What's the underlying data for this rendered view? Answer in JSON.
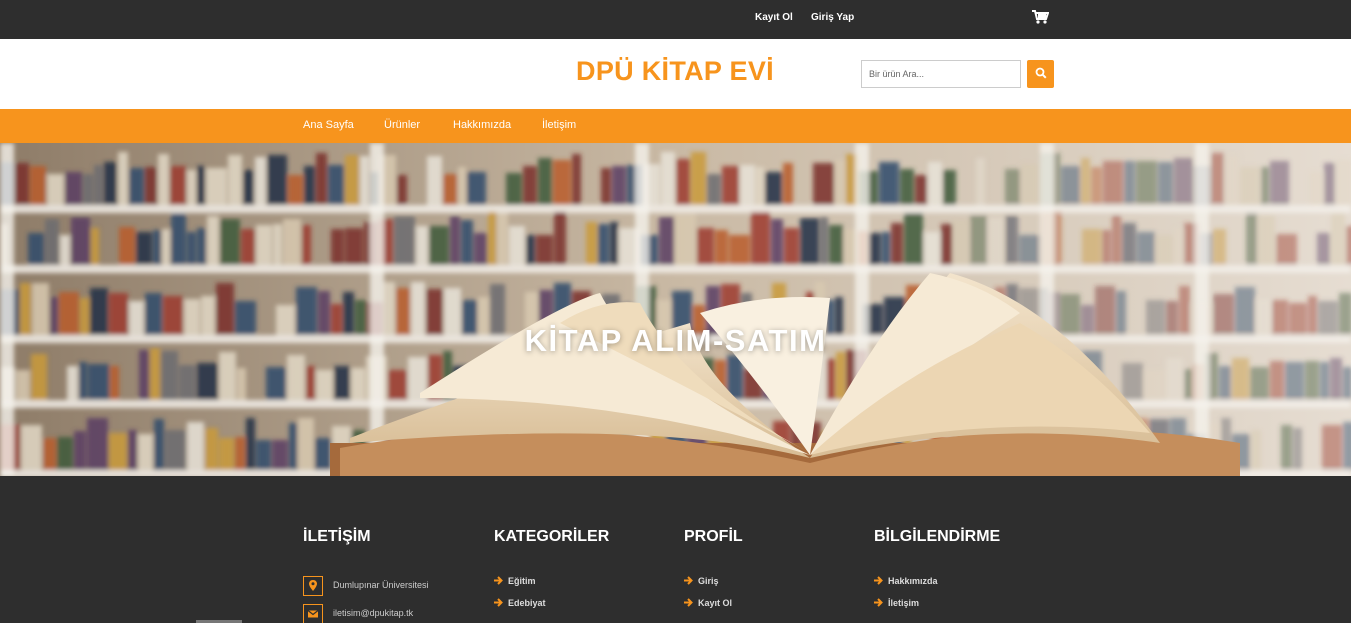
{
  "topbar": {
    "register_label": "Kayıt Ol",
    "login_label": "Giriş Yap",
    "cart_icon": "cart-icon"
  },
  "header": {
    "logo": "DPÜ KİTAP EVİ",
    "search_placeholder": "Bir ürün Ara...",
    "search_icon": "search-icon"
  },
  "nav": {
    "items": [
      {
        "label": "Ana Sayfa"
      },
      {
        "label": "Ürünler"
      },
      {
        "label": "Hakkımızda"
      },
      {
        "label": "İletişim"
      }
    ]
  },
  "hero": {
    "title": "KİTAP ALIM-SATIM"
  },
  "footer": {
    "contact": {
      "title": "İLETİŞİM",
      "address": "Dumlupınar Üniversitesi",
      "email": "iletisim@dpukitap.tk"
    },
    "categories": {
      "title": "KATEGORİLER",
      "items": [
        "Eğitim",
        "Edebiyat"
      ]
    },
    "profile": {
      "title": "PROFİL",
      "items": [
        "Giriş",
        "Kayıt Ol"
      ]
    },
    "info": {
      "title": "BİLGİLENDİRME",
      "items": [
        "Hakkımızda",
        "İletişim"
      ]
    }
  },
  "colors": {
    "accent": "#f7941d",
    "dark": "#2e2e2e"
  }
}
